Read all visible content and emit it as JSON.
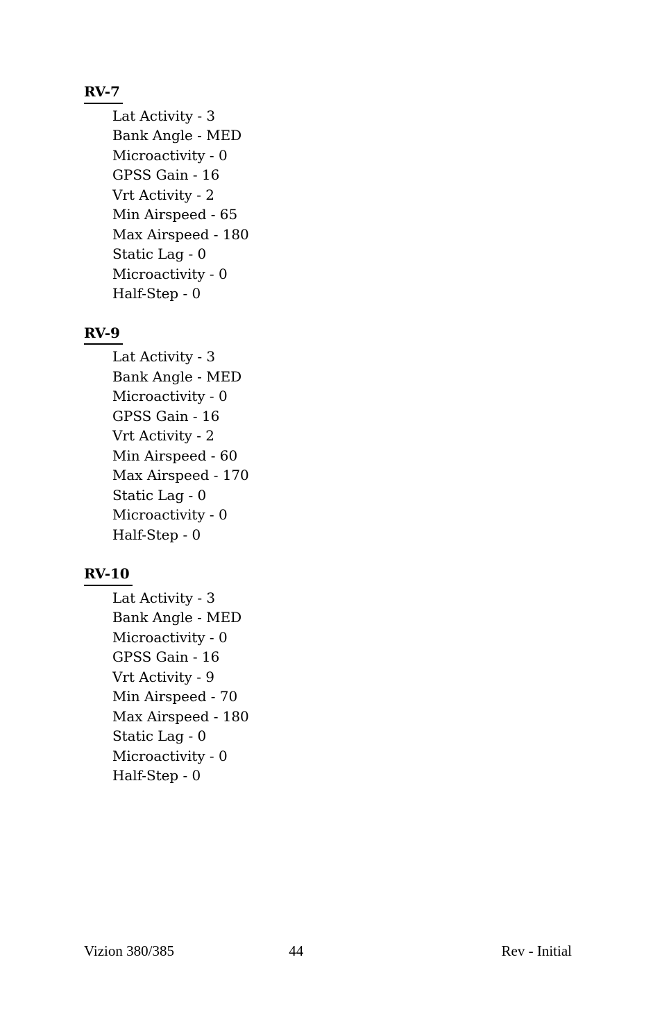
{
  "document": {
    "sections": [
      {
        "heading": "RV-7",
        "items": [
          "Lat Activity - 3",
          "Bank Angle - MED",
          "Microactivity - 0",
          "GPSS Gain - 16",
          "Vrt Activity - 2",
          "Min Airspeed - 65",
          "Max Airspeed - 180",
          "Static Lag - 0",
          "Microactivity - 0",
          "Half-Step - 0"
        ]
      },
      {
        "heading": "RV-9",
        "items": [
          "Lat Activity - 3",
          "Bank Angle - MED",
          "Microactivity - 0",
          "GPSS Gain - 16",
          "Vrt Activity - 2",
          "Min Airspeed - 60",
          "Max Airspeed - 170",
          "Static Lag - 0",
          "Microactivity - 0",
          "Half-Step - 0"
        ]
      },
      {
        "heading": "RV-10",
        "items": [
          "Lat Activity - 3",
          "Bank Angle - MED",
          "Microactivity - 0",
          "GPSS Gain - 16",
          "Vrt Activity - 9",
          "Min Airspeed - 70",
          "Max Airspeed - 180",
          "Static Lag - 0",
          "Microactivity - 0",
          "Half-Step - 0"
        ]
      }
    ],
    "footer": {
      "left": "Vizion 380/385",
      "page_number": "44",
      "right": "Rev - Initial"
    }
  }
}
